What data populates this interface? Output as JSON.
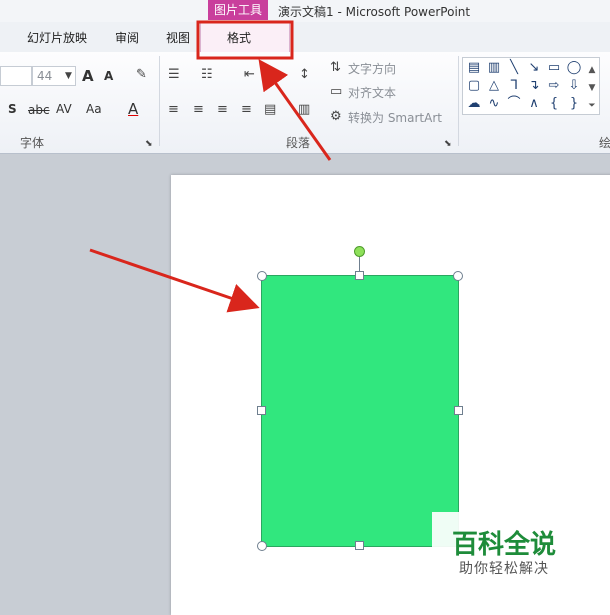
{
  "window": {
    "contextual_tab": "图片工具",
    "title": "演示文稿1  -  Microsoft PowerPoint"
  },
  "tabs": [
    "幻灯片放映",
    "审阅",
    "视图",
    "格式"
  ],
  "ribbon": {
    "font": {
      "size": "44",
      "grow": "A",
      "shrink": "A",
      "shadow": "S",
      "strike": "abc",
      "spacing": "AV",
      "case": "Aa",
      "color": "A",
      "group_label": "字体"
    },
    "paragraph": {
      "text_direction": "文字方向",
      "align_text": "对齐文本",
      "smartart": "转换为 SmartArt",
      "group_label": "段落"
    },
    "drawing": {
      "group_label_partial": "绘"
    }
  },
  "watermark": {
    "name": "百科全说",
    "tagline": "助你轻松解决"
  },
  "colors": {
    "shape_fill": "#31e77e",
    "context_tab": "#c93f9c",
    "highlight_box": "#d9261c",
    "arrow": "#d9261c",
    "watermark_green": "#1e8c3a"
  }
}
